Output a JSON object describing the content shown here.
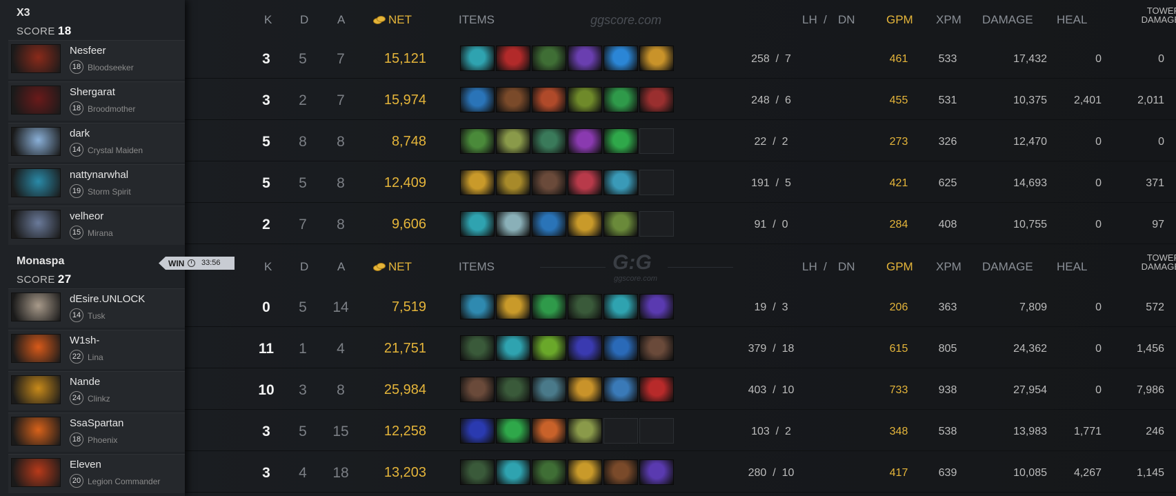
{
  "columns": {
    "k": "K",
    "d": "D",
    "a": "A",
    "net": "NET",
    "items": "ITEMS",
    "lh": "LH",
    "slash": "/",
    "dn": "DN",
    "gpm": "GPM",
    "xpm": "XPM",
    "damage": "DAMAGE",
    "heal": "HEAL",
    "tower1": "TOWER",
    "tower2": "DAMAGE"
  },
  "watermark": {
    "text": "ggscore.com",
    "logo": "G:G",
    "logo_sub": "ggscore.com"
  },
  "result": {
    "label": "WIN",
    "duration": "33:56"
  },
  "teams": [
    {
      "name": "X3",
      "score_label": "SCORE",
      "score": "18",
      "players": [
        {
          "name": "Nesfeer",
          "level": "18",
          "hero": "Bloodseeker",
          "k": "3",
          "d": "5",
          "a": "7",
          "net": "15,121",
          "lh": "258",
          "dn": "7",
          "gpm": "461",
          "xpm": "533",
          "damage": "17,432",
          "heal": "0",
          "tower": "0",
          "items": [
            "#2fa3b0",
            "#b22a2a",
            "#3f6e35",
            "#6a3fb0",
            "#2b86d6",
            "#c9932a"
          ]
        },
        {
          "name": "Shergarat",
          "level": "18",
          "hero": "Broodmother",
          "k": "3",
          "d": "2",
          "a": "7",
          "net": "15,974",
          "lh": "248",
          "dn": "6",
          "gpm": "455",
          "xpm": "531",
          "damage": "10,375",
          "heal": "2,401",
          "tower": "2,011",
          "items": [
            "#2a74b8",
            "#7a4a2a",
            "#b04a2a",
            "#6f8a2a",
            "#2f9a4a",
            "#9a2f2f"
          ]
        },
        {
          "name": "dark",
          "level": "14",
          "hero": "Crystal Maiden",
          "k": "5",
          "d": "8",
          "a": "8",
          "net": "8,748",
          "lh": "22",
          "dn": "2",
          "gpm": "273",
          "xpm": "326",
          "damage": "12,470",
          "heal": "0",
          "tower": "0",
          "items": [
            "#4a8a3a",
            "#8a9a4a",
            "#3a7a5a",
            "#8a3ab0",
            "#2fa84a",
            "empty"
          ]
        },
        {
          "name": "nattynarwhal",
          "level": "19",
          "hero": "Storm Spirit",
          "k": "5",
          "d": "5",
          "a": "8",
          "net": "12,409",
          "lh": "191",
          "dn": "5",
          "gpm": "421",
          "xpm": "625",
          "damage": "14,693",
          "heal": "0",
          "tower": "371",
          "items": [
            "#c99a2a",
            "#a88a2a",
            "#6a4a3a",
            "#b83a4a",
            "#3a9ab8",
            "empty"
          ]
        },
        {
          "name": "velheor",
          "level": "15",
          "hero": "Mirana",
          "k": "2",
          "d": "7",
          "a": "8",
          "net": "9,606",
          "lh": "91",
          "dn": "0",
          "gpm": "284",
          "xpm": "408",
          "damage": "10,755",
          "heal": "0",
          "tower": "97",
          "items": [
            "#2fa3b0",
            "#8ab0b8",
            "#2a74b8",
            "#c99a2a",
            "#6a8a3a",
            "empty"
          ]
        }
      ]
    },
    {
      "name": "Monaspa",
      "score_label": "SCORE",
      "score": "27",
      "players": [
        {
          "name": "dEsire.UNLOCK",
          "level": "14",
          "hero": "Tusk",
          "k": "0",
          "d": "5",
          "a": "14",
          "net": "7,519",
          "lh": "19",
          "dn": "3",
          "gpm": "206",
          "xpm": "363",
          "damage": "7,809",
          "heal": "0",
          "tower": "572",
          "items": [
            "#2f8ab0",
            "#c99a2a",
            "#2f9a4a",
            "#3a5a3a",
            "#2fa3b0",
            "#5a3ab0"
          ]
        },
        {
          "name": "W1sh-",
          "level": "22",
          "hero": "Lina",
          "k": "11",
          "d": "1",
          "a": "4",
          "net": "21,751",
          "lh": "379",
          "dn": "18",
          "gpm": "615",
          "xpm": "805",
          "damage": "24,362",
          "heal": "0",
          "tower": "1,456",
          "items": [
            "#3a5a3a",
            "#2fa3b0",
            "#6aa82a",
            "#3a3ab0",
            "#2a6ab8",
            "#6a4a3a"
          ]
        },
        {
          "name": "Nande",
          "level": "24",
          "hero": "Clinkz",
          "k": "10",
          "d": "3",
          "a": "8",
          "net": "25,984",
          "lh": "403",
          "dn": "10",
          "gpm": "733",
          "xpm": "938",
          "damage": "27,954",
          "heal": "0",
          "tower": "7,986",
          "items": [
            "#6a4a3a",
            "#3a5a3a",
            "#4a7a8a",
            "#c9932a",
            "#3a7ab8",
            "#b82a2a"
          ]
        },
        {
          "name": "SsaSpartan",
          "level": "18",
          "hero": "Phoenix",
          "k": "3",
          "d": "5",
          "a": "15",
          "net": "12,258",
          "lh": "103",
          "dn": "2",
          "gpm": "348",
          "xpm": "538",
          "damage": "13,983",
          "heal": "1,771",
          "tower": "246",
          "items": [
            "#2a3ab0",
            "#2fa84a",
            "#c9622a",
            "#8a9a4a",
            "empty",
            "empty"
          ]
        },
        {
          "name": "Eleven",
          "level": "20",
          "hero": "Legion Commander",
          "k": "3",
          "d": "4",
          "a": "18",
          "net": "13,203",
          "lh": "280",
          "dn": "10",
          "gpm": "417",
          "xpm": "639",
          "damage": "10,085",
          "heal": "4,267",
          "tower": "1,145",
          "items": [
            "#3a5a3a",
            "#2fa3b0",
            "#3f6e35",
            "#c99a2a",
            "#7a4a2a",
            "#5a3ab0"
          ]
        }
      ]
    }
  ],
  "hero_colors": {
    "Bloodseeker": "#8a2a1a",
    "Broodmother": "#6a1a1a",
    "Crystal Maiden": "#8ab0d8",
    "Storm Spirit": "#2a8aa8",
    "Mirana": "#6a7a9a",
    "Tusk": "#a89a8a",
    "Lina": "#d85a1a",
    "Clinkz": "#c88a1a",
    "Phoenix": "#d8621a",
    "Legion Commander": "#b83a1a"
  }
}
